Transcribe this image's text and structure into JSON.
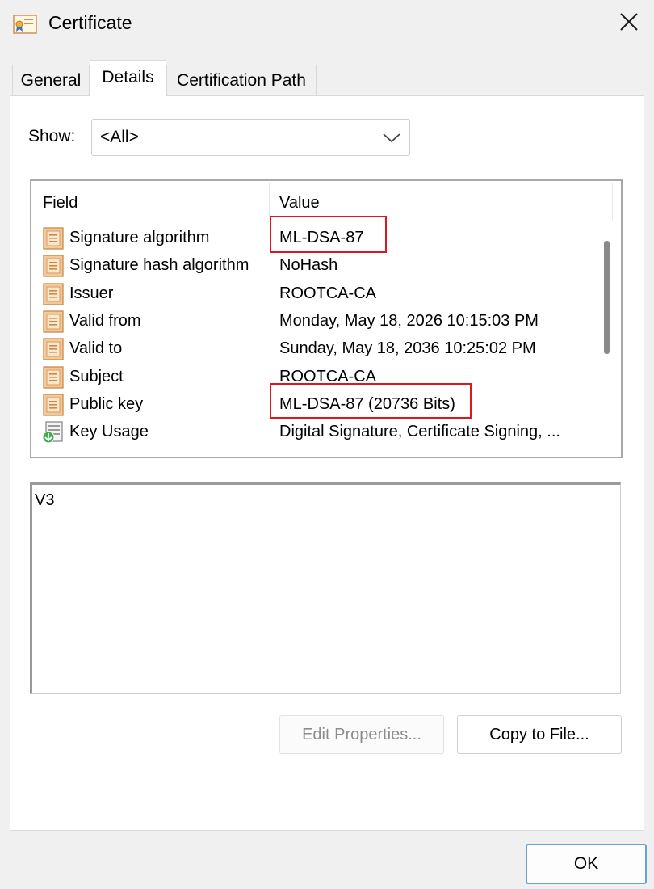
{
  "window": {
    "title": "Certificate",
    "icon": "certificate-icon",
    "close_icon": "close-icon"
  },
  "tabs": [
    {
      "label": "General",
      "selected": false
    },
    {
      "label": "Details",
      "selected": true
    },
    {
      "label": "Certification Path",
      "selected": false
    }
  ],
  "show": {
    "label": "Show:",
    "selected": "<All>"
  },
  "list": {
    "columns": {
      "field": "Field",
      "value": "Value"
    },
    "rows": [
      {
        "field": "Signature algorithm",
        "value": "ML-DSA-87",
        "icon": "certificate-field-icon",
        "highlighted": true
      },
      {
        "field": "Signature hash algorithm",
        "value": "NoHash",
        "icon": "certificate-field-icon"
      },
      {
        "field": "Issuer",
        "value": "ROOTCA-CA",
        "icon": "certificate-field-icon"
      },
      {
        "field": "Valid from",
        "value": "Monday, May 18, 2026 10:15:03 PM",
        "icon": "certificate-field-icon"
      },
      {
        "field": "Valid to",
        "value": "Sunday, May 18, 2036 10:25:02 PM",
        "icon": "certificate-field-icon"
      },
      {
        "field": "Subject",
        "value": "ROOTCA-CA",
        "icon": "certificate-field-icon"
      },
      {
        "field": "Public key",
        "value": "ML-DSA-87 (20736 Bits)",
        "icon": "certificate-field-icon",
        "highlighted": true
      },
      {
        "field": "Key Usage",
        "value": "Digital Signature, Certificate Signing, ...",
        "icon": "extension-field-icon"
      }
    ]
  },
  "detail": {
    "text": "V3"
  },
  "buttons": {
    "edit_properties": "Edit Properties...",
    "copy_to_file": "Copy to File...",
    "ok": "OK"
  },
  "colors": {
    "highlight_border": "#e0161f",
    "ok_border": "#6aa0d6"
  }
}
